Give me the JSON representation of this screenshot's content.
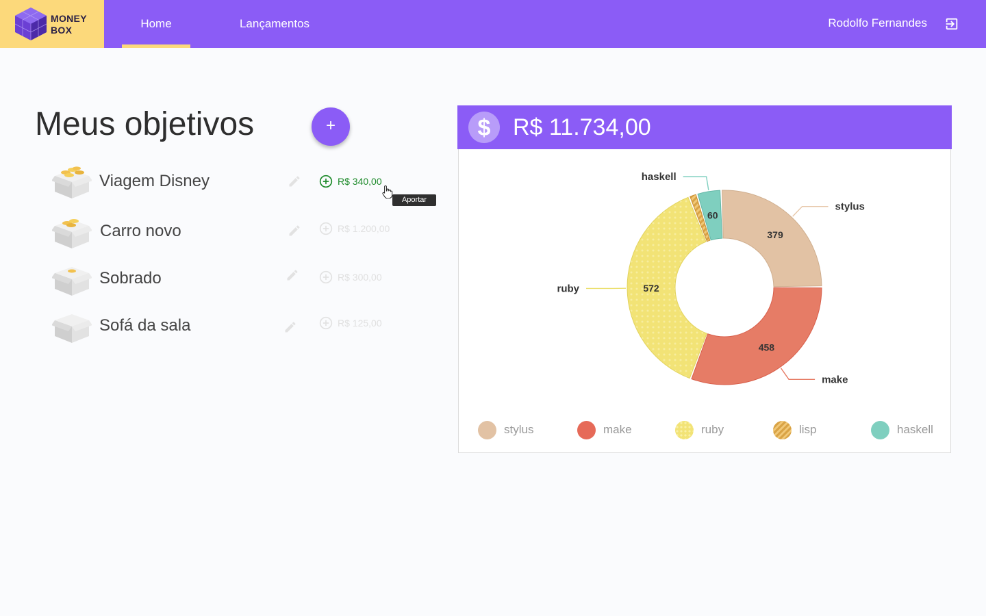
{
  "app": {
    "logo_text_line1": "MONEY",
    "logo_text_line2": "BOX"
  },
  "nav": {
    "tabs": [
      {
        "label": "Home",
        "active": true
      },
      {
        "label": "Lançamentos",
        "active": false
      }
    ],
    "user_name": "Rodolfo Fernandes"
  },
  "main": {
    "title": "Meus objetivos",
    "add_button_label": "+",
    "goals": [
      {
        "name": "Viagem Disney",
        "amount": "R$ 340,00",
        "active": true
      },
      {
        "name": "Carro novo",
        "amount": "R$ 1.200,00",
        "active": false
      },
      {
        "name": "Sobrado",
        "amount": "R$ 300,00",
        "active": false
      },
      {
        "name": "Sofá da sala",
        "amount": "R$ 125,00",
        "active": false
      }
    ],
    "tooltip": "Aportar"
  },
  "summary": {
    "total": "R$ 11.734,00"
  },
  "colors": {
    "brand": "#8b5cf6",
    "accent": "#fcd97b",
    "active_green": "#1d8a2a"
  },
  "chart_data": {
    "type": "pie",
    "donut": true,
    "categories": [
      "stylus",
      "make",
      "ruby",
      "lisp",
      "haskell"
    ],
    "values": [
      379,
      458,
      572,
      20,
      60
    ],
    "value_labels": [
      "379",
      "458",
      "572",
      "",
      "60"
    ],
    "colors": [
      "#e2c2a4",
      "#e67c66",
      "#f2e376",
      "#e8b25c",
      "#7fcfbf"
    ],
    "legend_position": "bottom"
  }
}
